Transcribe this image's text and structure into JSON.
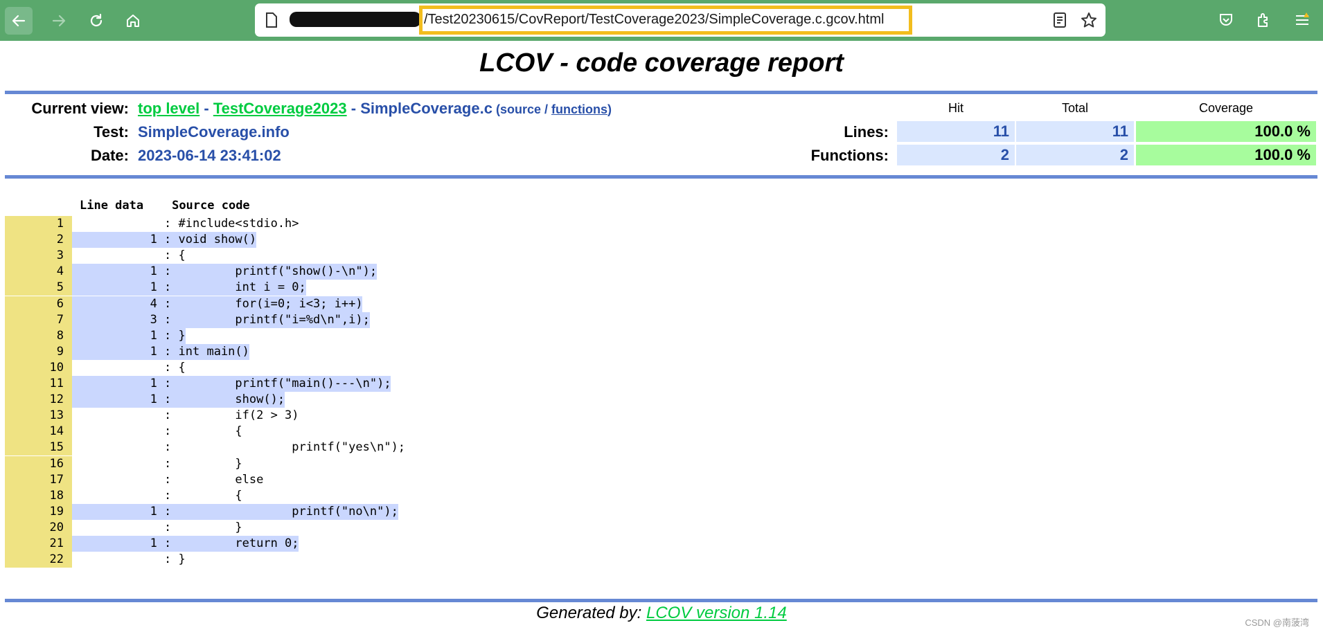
{
  "browser": {
    "url": "/Test20230615/CovReport/TestCoverage2023/SimpleCoverage.c.gcov.html"
  },
  "title": "LCOV - code coverage report",
  "header": {
    "current_view_label": "Current view:",
    "crumb_top": "top level",
    "crumb_sep1": " - ",
    "crumb_dir": "TestCoverage2023",
    "crumb_sep2": " - ",
    "crumb_file": "SimpleCoverage.c",
    "view_open": " (",
    "view_source": "source",
    "view_sep": " / ",
    "view_functions": "functions",
    "view_close": ")",
    "test_label": "Test:",
    "test_value": "SimpleCoverage.info",
    "date_label": "Date:",
    "date_value": "2023-06-14 23:41:02"
  },
  "stats": {
    "col_hit": "Hit",
    "col_total": "Total",
    "col_coverage": "Coverage",
    "lines_label": "Lines:",
    "lines_hit": "11",
    "lines_total": "11",
    "lines_cov": "100.0 %",
    "funcs_label": "Functions:",
    "funcs_hit": "2",
    "funcs_total": "2",
    "funcs_cov": "100.0 %"
  },
  "code": {
    "head_linedata": "Line data",
    "head_source": "Source code",
    "lines": [
      {
        "n": "1",
        "hits": "",
        "text": "#include<stdio.h>"
      },
      {
        "n": "2",
        "hits": "1",
        "text": "void show()"
      },
      {
        "n": "3",
        "hits": "",
        "text": "{"
      },
      {
        "n": "4",
        "hits": "1",
        "text": "        printf(\"show()-\\n\");"
      },
      {
        "n": "5",
        "hits": "1",
        "text": "        int i = 0;"
      },
      {
        "n": "6",
        "hits": "4",
        "text": "        for(i=0; i<3; i++)"
      },
      {
        "n": "7",
        "hits": "3",
        "text": "        printf(\"i=%d\\n\",i);"
      },
      {
        "n": "8",
        "hits": "1",
        "text": "}"
      },
      {
        "n": "9",
        "hits": "1",
        "text": "int main()"
      },
      {
        "n": "10",
        "hits": "",
        "text": "{"
      },
      {
        "n": "11",
        "hits": "1",
        "text": "        printf(\"main()---\\n\");"
      },
      {
        "n": "12",
        "hits": "1",
        "text": "        show();"
      },
      {
        "n": "13",
        "hits": "",
        "text": "        if(2 > 3)"
      },
      {
        "n": "14",
        "hits": "",
        "text": "        {"
      },
      {
        "n": "15",
        "hits": "",
        "text": "                printf(\"yes\\n\");"
      },
      {
        "n": "16",
        "hits": "",
        "text": "        }"
      },
      {
        "n": "17",
        "hits": "",
        "text": "        else"
      },
      {
        "n": "18",
        "hits": "",
        "text": "        {"
      },
      {
        "n": "19",
        "hits": "1",
        "text": "                printf(\"no\\n\");"
      },
      {
        "n": "20",
        "hits": "",
        "text": "        }"
      },
      {
        "n": "21",
        "hits": "1",
        "text": "        return 0;"
      },
      {
        "n": "22",
        "hits": "",
        "text": "}"
      }
    ]
  },
  "footer": {
    "prefix": "Generated by: ",
    "link": "LCOV version 1.14"
  },
  "watermark": "CSDN @南菠湾"
}
